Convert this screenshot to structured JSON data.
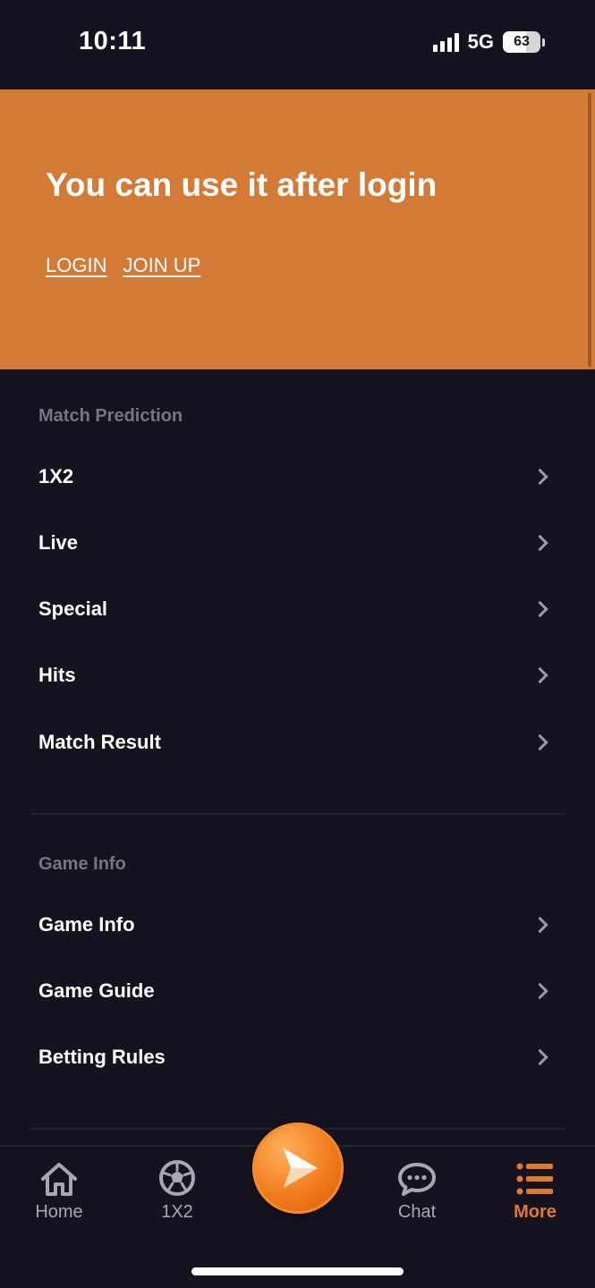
{
  "status": {
    "time": "10:11",
    "network": "5G",
    "battery": "63",
    "battery_fraction": 0.63
  },
  "banner": {
    "title": "You can use it after login",
    "login": "LOGIN",
    "join": "JOIN UP"
  },
  "sections": {
    "match_prediction": {
      "title": "Match Prediction",
      "items": [
        "1X2",
        "Live",
        "Special",
        "Hits",
        "Match Result"
      ]
    },
    "game_info": {
      "title": "Game Info",
      "items": [
        "Game Info",
        "Game Guide",
        "Betting Rules"
      ]
    }
  },
  "tabs": {
    "home": "Home",
    "x12": "1X2",
    "chat": "Chat",
    "more": "More"
  },
  "colors": {
    "accent": "#d27a36",
    "active_tab": "#e07b2e",
    "background": "#15131f"
  }
}
